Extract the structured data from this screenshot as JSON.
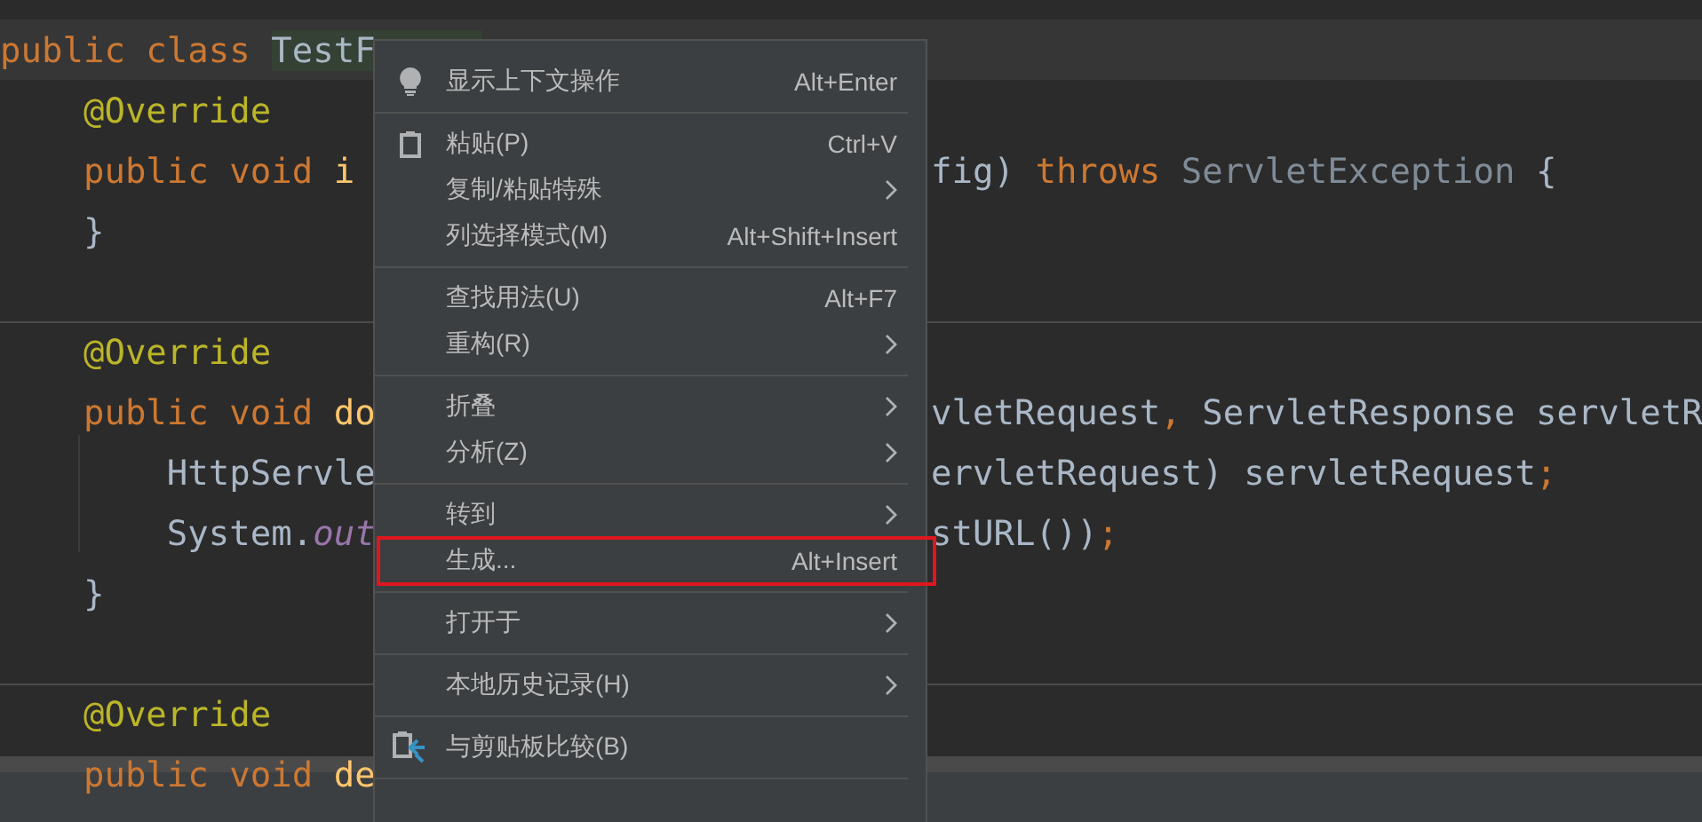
{
  "editor": {
    "lines": [
      {
        "current": true,
        "divider_above": false,
        "left": [
          {
            "kind": "keyword",
            "text": "public class "
          },
          {
            "kind": "match",
            "text": "TestF"
          }
        ]
      },
      {
        "current": false,
        "divider_above": false,
        "left": [
          {
            "kind": "annotation",
            "text": "    @Override"
          }
        ]
      },
      {
        "current": false,
        "divider_above": false,
        "left": [
          {
            "kind": "keyword",
            "text": "    public void "
          },
          {
            "kind": "method",
            "text": "i"
          }
        ],
        "right": [
          {
            "kind": "plain",
            "text": "fig) "
          },
          {
            "kind": "keyword",
            "text": "throws "
          },
          {
            "kind": "muted",
            "text": "ServletException "
          },
          {
            "kind": "plain",
            "text": "{"
          }
        ]
      },
      {
        "current": false,
        "divider_above": false,
        "left": [
          {
            "kind": "plain",
            "text": "    }"
          }
        ]
      },
      {
        "current": false,
        "divider_above": true,
        "left": [
          {
            "kind": "annotation",
            "text": "    @Override"
          }
        ]
      },
      {
        "current": false,
        "divider_above": false,
        "left": [
          {
            "kind": "keyword",
            "text": "    public void "
          },
          {
            "kind": "method",
            "text": "do"
          }
        ],
        "right": [
          {
            "kind": "plain",
            "text": "vletRequest"
          },
          {
            "kind": "keyword",
            "text": ", "
          },
          {
            "kind": "plain",
            "text": "ServletResponse servletR"
          }
        ]
      },
      {
        "current": false,
        "divider_above": false,
        "left": [
          {
            "kind": "plain",
            "text": "        HttpServle"
          }
        ],
        "right": [
          {
            "kind": "plain",
            "text": "ervletRequest) servletRequest"
          },
          {
            "kind": "keyword",
            "text": ";"
          }
        ]
      },
      {
        "current": false,
        "divider_above": false,
        "left": [
          {
            "kind": "plain",
            "text": "        System."
          },
          {
            "kind": "field",
            "text": "out"
          }
        ],
        "right": [
          {
            "kind": "plain",
            "text": "stURL())"
          },
          {
            "kind": "keyword",
            "text": ";"
          }
        ]
      },
      {
        "current": false,
        "divider_above": false,
        "left": [
          {
            "kind": "plain",
            "text": "    }"
          }
        ]
      },
      {
        "current": false,
        "divider_above": true,
        "left": [
          {
            "kind": "annotation",
            "text": "    @Override"
          }
        ]
      },
      {
        "current": false,
        "divider_above": false,
        "left": [
          {
            "kind": "keyword",
            "text": "    public void "
          },
          {
            "kind": "method",
            "text": "de"
          }
        ]
      }
    ]
  },
  "context_menu": {
    "sections": [
      [
        {
          "kind": "icon",
          "label": "显示上下文操作",
          "shortcut": "Alt+Enter",
          "submenu": false,
          "outlined": false
        }
      ],
      [
        {
          "kind": "icon",
          "label": "粘贴(P)",
          "shortcut": "Ctrl+V",
          "submenu": false,
          "outlined": false
        },
        {
          "kind": "text",
          "label": "复制/粘贴特殊",
          "submenu": true,
          "outlined": false
        },
        {
          "kind": "text",
          "label": "列选择模式(M)",
          "shortcut": "Alt+Shift+Insert",
          "submenu": false,
          "outlined": false
        }
      ],
      [
        {
          "kind": "text",
          "label": "查找用法(U)",
          "shortcut": "Alt+F7",
          "submenu": false,
          "outlined": false
        },
        {
          "kind": "text",
          "label": "重构(R)",
          "submenu": true,
          "outlined": false
        }
      ],
      [
        {
          "kind": "text",
          "label": "折叠",
          "submenu": true,
          "outlined": false
        },
        {
          "kind": "text",
          "label": "分析(Z)",
          "submenu": true,
          "outlined": false
        }
      ],
      [
        {
          "kind": "text",
          "label": "转到",
          "submenu": true,
          "outlined": false
        },
        {
          "kind": "text",
          "label": "生成...",
          "shortcut": "Alt+Insert",
          "submenu": false,
          "outlined": true
        }
      ],
      [
        {
          "kind": "text",
          "label": "打开于",
          "submenu": true,
          "outlined": false
        }
      ],
      [
        {
          "kind": "text",
          "label": "本地历史记录(H)",
          "submenu": true,
          "outlined": false
        }
      ],
      [
        {
          "kind": "icon",
          "label": "与剪贴板比较(B)",
          "submenu": false,
          "outlined": false
        }
      ]
    ]
  }
}
